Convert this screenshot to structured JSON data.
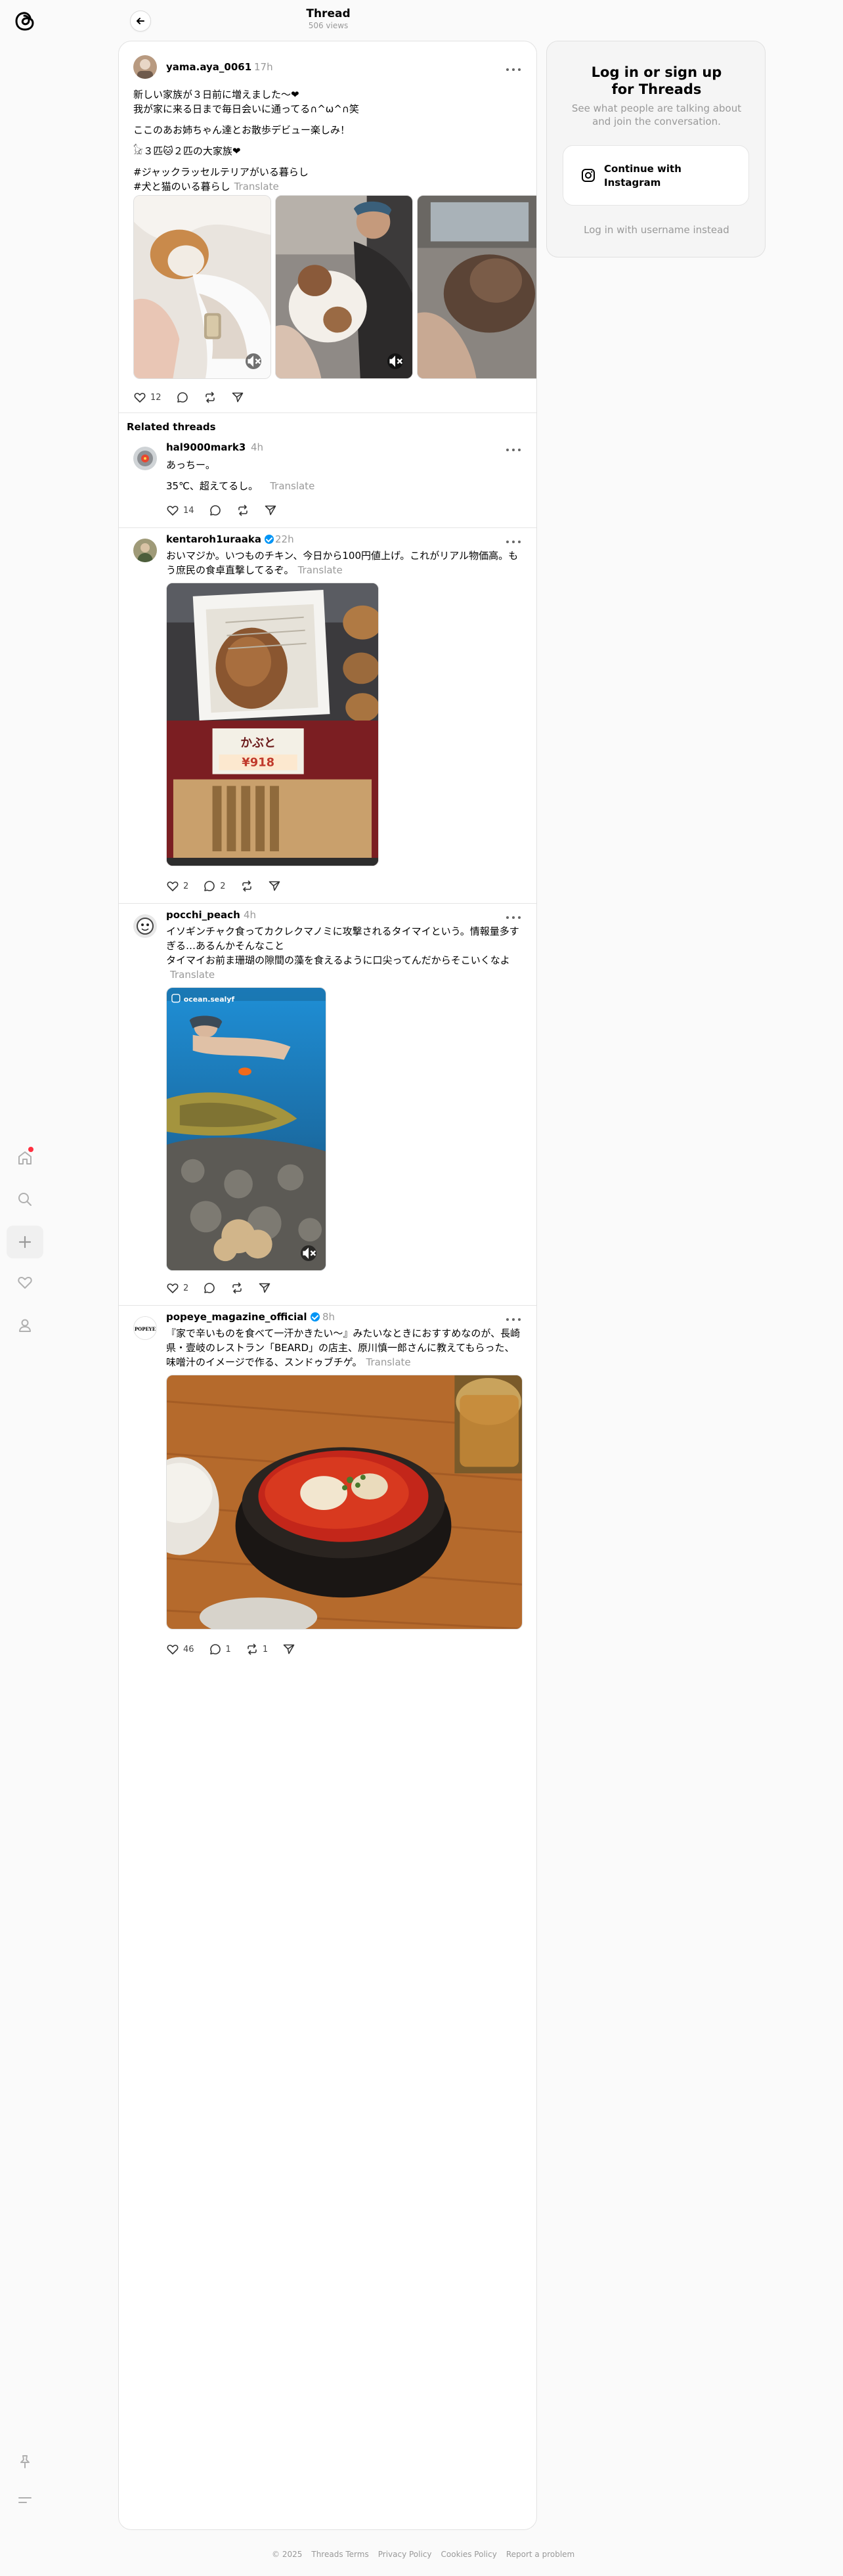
{
  "header": {
    "title": "Thread",
    "views": "506 views"
  },
  "thread": {
    "username": "yama.aya_0061",
    "time": "17h",
    "lines": [
      "新しい家族が３日前に増えました〜❤",
      "我が家に来る日まで毎日会いに通ってる∩^ω^∩笑",
      "ここのあお姉ちゃん達とお散歩デビュー楽しみ！",
      "𓃠３匹🐱２匹の大家族❤",
      "#ジャックラッセルテリアがいる暮らし",
      "#犬と猫のいる暮らし"
    ],
    "translate": "Translate",
    "likes": "12"
  },
  "related": {
    "heading": "Related threads",
    "posts": [
      {
        "username": "hal9000mark3",
        "time": "4h",
        "lines": [
          "あっちー。",
          "35℃、超えてるし。"
        ],
        "translate": "Translate",
        "likes": "14"
      },
      {
        "username": "kentaroh1uraaka",
        "time": "22h",
        "text": "おいマジか。いつものチキン、今日から100円値上げ。これがリアル物価高。もう庶民の食卓直撃してるぞ。",
        "translate": "Translate",
        "likes": "2",
        "replies": "2",
        "price_tag": "¥918"
      },
      {
        "username": "pocchi_peach",
        "time": "4h",
        "text1": "イソギンチャク食ってカクレクマノミに攻撃されるタイマイという。情報量多すぎる…あるんかそんなこと",
        "text2": "タイマイお前ま珊瑚の隙間の藻を食えるように口尖ってんだからそこいくなよ",
        "translate": "Translate",
        "likes": "2",
        "watermark": "ocean.sealyf"
      },
      {
        "username": "popeye_magazine_official",
        "time": "8h",
        "text": "『家で辛いものを食べて一汗かきたい〜』みたいなときにおすすめなのが、長崎県・壹岐のレストラン「BEARD」の店主、原川慎一郎さんに教えてもらった、味噌汁のイメージで作る、スンドゥブチゲ。",
        "translate": "Translate",
        "likes": "46",
        "replies": "1",
        "reposts": "1",
        "avatar_text": "POPEYE"
      }
    ]
  },
  "login": {
    "title_line1": "Log in or sign up",
    "title_line2": "for Threads",
    "subtitle": "See what people are talking about and join the conversation.",
    "instagram_button": "Continue with Instagram",
    "alt_login": "Log in with username instead"
  },
  "footer": {
    "copyright": "© 2025",
    "links": [
      "Threads Terms",
      "Privacy Policy",
      "Cookies Policy",
      "Report a problem"
    ]
  },
  "colors": {
    "verified": "#0095f6",
    "notification_dot": "#ff3040",
    "muted_text": "#999999"
  }
}
